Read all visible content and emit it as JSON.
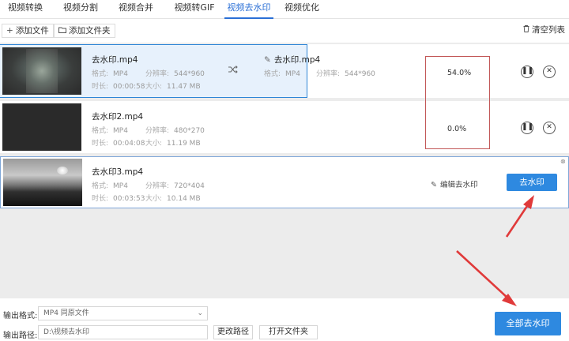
{
  "tabs": [
    {
      "label": "视频转换"
    },
    {
      "label": "视频分割"
    },
    {
      "label": "视频合并"
    },
    {
      "label": "视频转GIF"
    },
    {
      "label": "视频去水印"
    },
    {
      "label": "视频优化"
    }
  ],
  "toolbar": {
    "add_file": "添加文件",
    "add_folder": "添加文件夹",
    "clear_list": "清空列表"
  },
  "meta_labels": {
    "format": "格式:",
    "resolution": "分辨率:",
    "duration": "时长:",
    "size": "大小:"
  },
  "files": [
    {
      "name": "去水印.mp4",
      "format": "MP4",
      "resolution": "544*960",
      "duration": "00:00:58",
      "size": "11.47 MB",
      "output_name": "去水印.mp4",
      "output_format": "MP4",
      "output_resolution": "544*960",
      "progress_text": "54.0%",
      "progress": 0.54
    },
    {
      "name": "去水印2.mp4",
      "format": "MP4",
      "resolution": "480*270",
      "duration": "00:04:08",
      "size": "11.19 MB",
      "progress_text": "0.0%"
    },
    {
      "name": "去水印3.mp4",
      "format": "MP4",
      "resolution": "720*404",
      "duration": "00:03:53",
      "size": "10.14 MB",
      "edit_label": "编辑去水印",
      "action_label": "去水印"
    }
  ],
  "bottom": {
    "output_format_label": "输出格式:",
    "output_format_value": "MP4  同原文件",
    "output_path_label": "输出路径:",
    "output_path_value": "D:\\视频去水印",
    "change_path": "更改路径",
    "open_folder": "打开文件夹",
    "remove_all": "全部去水印"
  },
  "colors": {
    "accent": "#2e89e0",
    "active_tab": "#2a6fd6",
    "annotation_red": "#e03a3a"
  }
}
